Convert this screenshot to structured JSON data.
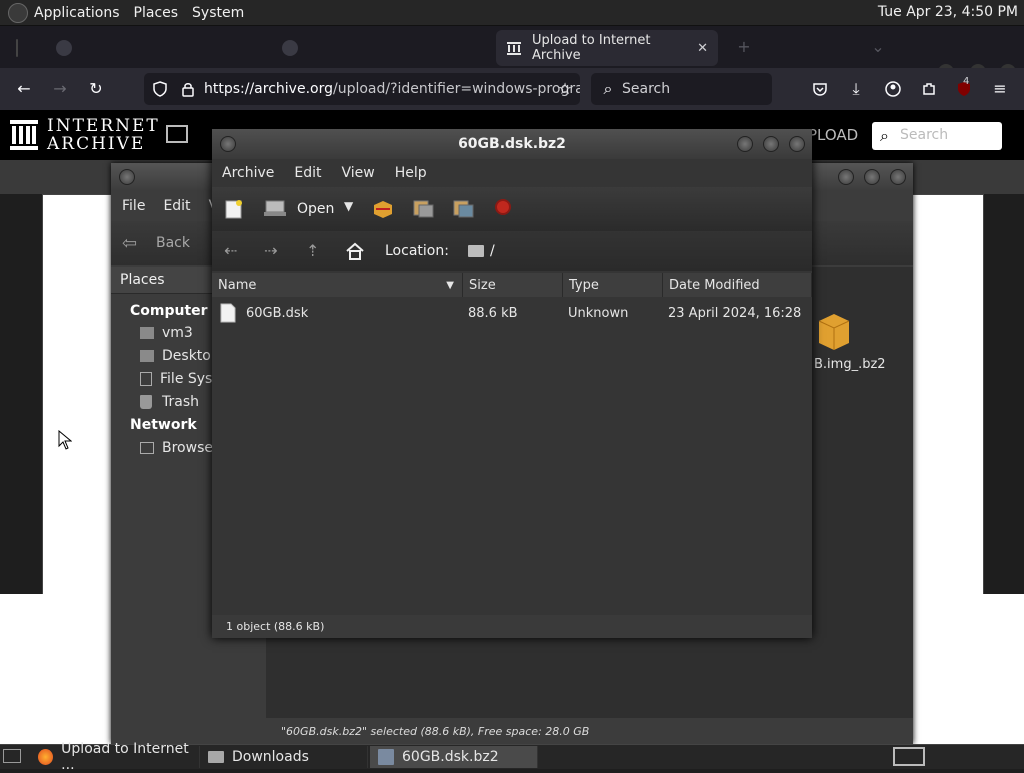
{
  "top_panel": {
    "menus": [
      "Applications",
      "Places",
      "System"
    ],
    "clock": "Tue Apr 23,  4:50 PM"
  },
  "browser": {
    "tabs": [
      {
        "label": "",
        "active": false
      },
      {
        "label": "",
        "active": false
      },
      {
        "label": "Upload to Internet Archive",
        "active": true
      }
    ],
    "url_host": "https://archive.org",
    "url_path": "/upload/?identifier=windows-progra",
    "search_placeholder": "Search",
    "extension_badge": "4"
  },
  "ia": {
    "logo_line1": "INTERNET",
    "logo_line2": "ARCHIVE",
    "upload_label": "PLOAD",
    "search_placeholder": "Search"
  },
  "caja": {
    "menus": [
      "File",
      "Edit",
      "V"
    ],
    "back_label": "Back",
    "places_label": "Places",
    "sidebar": {
      "computer_heading": "Computer",
      "items": [
        "vm3",
        "Desktop",
        "File Syst",
        "Trash"
      ],
      "network_heading": "Network",
      "network_items": [
        "Browse N"
      ]
    },
    "file_icon_label": "B.img_.bz2",
    "status": "\"60GB.dsk.bz2\" selected (88.6 kB), Free space: 28.0 GB"
  },
  "archive_manager": {
    "title": "60GB.dsk.bz2",
    "menus": [
      "Archive",
      "Edit",
      "View",
      "Help"
    ],
    "open_label": "Open",
    "location_label": "Location:",
    "location_path": "/",
    "columns": [
      "Name",
      "Size",
      "Type",
      "Date Modified"
    ],
    "rows": [
      {
        "name": "60GB.dsk",
        "size": "88.6 kB",
        "type": "Unknown",
        "modified": "23 April 2024, 16:28"
      }
    ],
    "status": "1 object (88.6 kB)"
  },
  "taskbar": {
    "items": [
      "Upload to Internet ...",
      "Downloads",
      "60GB.dsk.bz2"
    ]
  },
  "colors": {
    "panel": "#262626",
    "firefox_dark": "#1c1b22",
    "stop_red": "#c0281e"
  }
}
